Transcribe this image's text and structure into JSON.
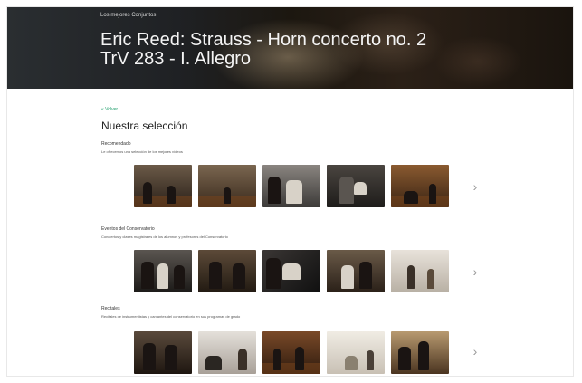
{
  "hero": {
    "source": "Los mejores Conjuntos",
    "title_line1": "Eric Reed: Strauss - Horn concerto no. 2",
    "title_line2": "TrV 283 - I. Allegro"
  },
  "breadcrumb": "« Volver",
  "section_heading": "Nuestra selección",
  "rows": [
    {
      "title": "Recomendado",
      "description": "Le ofrecemos una selección de los mejores vídeos",
      "next_label": "›"
    },
    {
      "title": "Eventos del Conservatorio",
      "description": "Conciertos y clases magistrales de los alumnos y profesores del Conservatorio",
      "next_label": "›"
    },
    {
      "title": "Recitales",
      "description": "Recitales de instrumentistas y cantantes del conservatorio en sus programas de grado",
      "next_label": "›"
    }
  ]
}
